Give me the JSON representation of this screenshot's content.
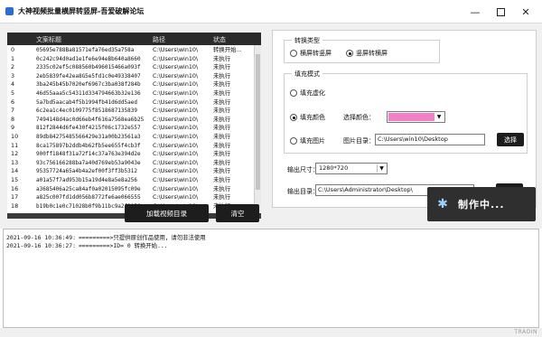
{
  "window": {
    "title": "大神视频批量横屏转竖屏-吾爱破解论坛",
    "minimize_glyph": "—",
    "close_glyph": "✕"
  },
  "table": {
    "columns": [
      "",
      "文案标题",
      "路径",
      "状态"
    ],
    "rows": [
      {
        "idx": "0",
        "name": "05695e788Ba81571efa76ed35a758a",
        "path": "C:\\Users\\win10\\",
        "state": "转换开始..."
      },
      {
        "idx": "1",
        "name": "0c242c94d0ad1e1fe6e94eBb640a8660",
        "path": "C:\\Users\\win10\\",
        "state": "未执行"
      },
      {
        "idx": "2",
        "name": "2335c02ef5c088560b496015466a093f",
        "path": "C:\\Users\\win10\\",
        "state": "未执行"
      },
      {
        "idx": "3",
        "name": "2eb5839fe42ea8G5e5fd1c0e49338407",
        "path": "C:\\Users\\win10\\",
        "state": "未执行"
      },
      {
        "idx": "4",
        "name": "3ba245b45b7020ef6967c3ba038f284b",
        "path": "C:\\Users\\win10\\",
        "state": "未执行"
      },
      {
        "idx": "5",
        "name": "46d55aaa5c54311d334794663b32e136",
        "path": "C:\\Users\\win10\\",
        "state": "未执行"
      },
      {
        "idx": "6",
        "name": "5a7bd5aacab4f5b1994fb41d6dd5aed",
        "path": "C:\\Users\\win10\\",
        "state": "未执行"
      },
      {
        "idx": "7",
        "name": "6c2ea1c4ec0109775f8518687135839",
        "path": "C:\\Users\\win10\\",
        "state": "未执行"
      },
      {
        "idx": "8",
        "name": "7494148d4ac0d66eb4f616a7568ea6b25",
        "path": "C:\\Users\\win10\\",
        "state": "未执行"
      },
      {
        "idx": "9",
        "name": "812f2844d6fe430f4215f06c1732e557",
        "path": "C:\\Users\\win10\\",
        "state": "未执行"
      },
      {
        "idx": "10",
        "name": "89db84275485566429e31a00b23561a3",
        "path": "C:\\Users\\win10\\",
        "state": "未执行"
      },
      {
        "idx": "11",
        "name": "8ca175897b2ddb4b62fb5ee655f4cb3f",
        "path": "C:\\Users\\win10\\",
        "state": "未执行"
      },
      {
        "idx": "12",
        "name": "900ff1848f31a72f14c37a763e394d2e",
        "path": "C:\\Users\\win10\\",
        "state": "未执行"
      },
      {
        "idx": "13",
        "name": "93c756166288ba7a40d769eb53a9043e",
        "path": "C:\\Users\\win10\\",
        "state": "未执行"
      },
      {
        "idx": "14",
        "name": "95357724a65a4b4a2ef00f3ff3b5312",
        "path": "C:\\Users\\win10\\",
        "state": "未执行"
      },
      {
        "idx": "15",
        "name": "a01a57f7ad953b15a19d4e8a5e8a256",
        "path": "C:\\Users\\win10\\",
        "state": "未执行"
      },
      {
        "idx": "16",
        "name": "a3685406a25ca84af0a02015095fc09e",
        "path": "C:\\Users\\win10\\",
        "state": "未执行"
      },
      {
        "idx": "17",
        "name": "a825c007fd1dd056b8772fe6ae066555",
        "path": "C:\\Users\\win10\\",
        "state": "未执行"
      },
      {
        "idx": "18",
        "name": "b19b0c1e0c71028b0f9b11bc9a2f3056",
        "path": "C:\\Users\\win10\\",
        "state": "未执行"
      }
    ]
  },
  "buttons": {
    "load": "加载视频目录",
    "clear": "清空"
  },
  "convert": {
    "group_title": "转换类型",
    "opt_h2v": "横屏转竖屏",
    "opt_v2h": "竖屏转横屏",
    "selected": "v2h"
  },
  "fill": {
    "group_title": "填充模式",
    "opt_blur": "填充虚化",
    "opt_color": "填充颜色",
    "opt_image": "填充图片",
    "selected": "color",
    "color_label": "选择颜色：",
    "color_value": "#f27fc8",
    "image_label": "图片目录：",
    "image_path": "C:\\Users\\win10\\Desktop",
    "image_button": "选择"
  },
  "output": {
    "size_label": "输出尺寸：",
    "size_value": "1280*720",
    "dir_label": "输出目录：",
    "dir_value": "C:\\Users\\Administrator\\Desktop\\",
    "dir_button": "选择"
  },
  "status": {
    "text": "制作中..."
  },
  "log": [
    {
      "time": "2021-09-16 10:36:49:",
      "msg": "=========>只提供原创作品使用，请勿非法使用"
    },
    {
      "time": "2021-09-16 10:36:27:",
      "msg": "=========>ID= 0 转换开始..."
    }
  ],
  "watermark": "TRAOIN"
}
